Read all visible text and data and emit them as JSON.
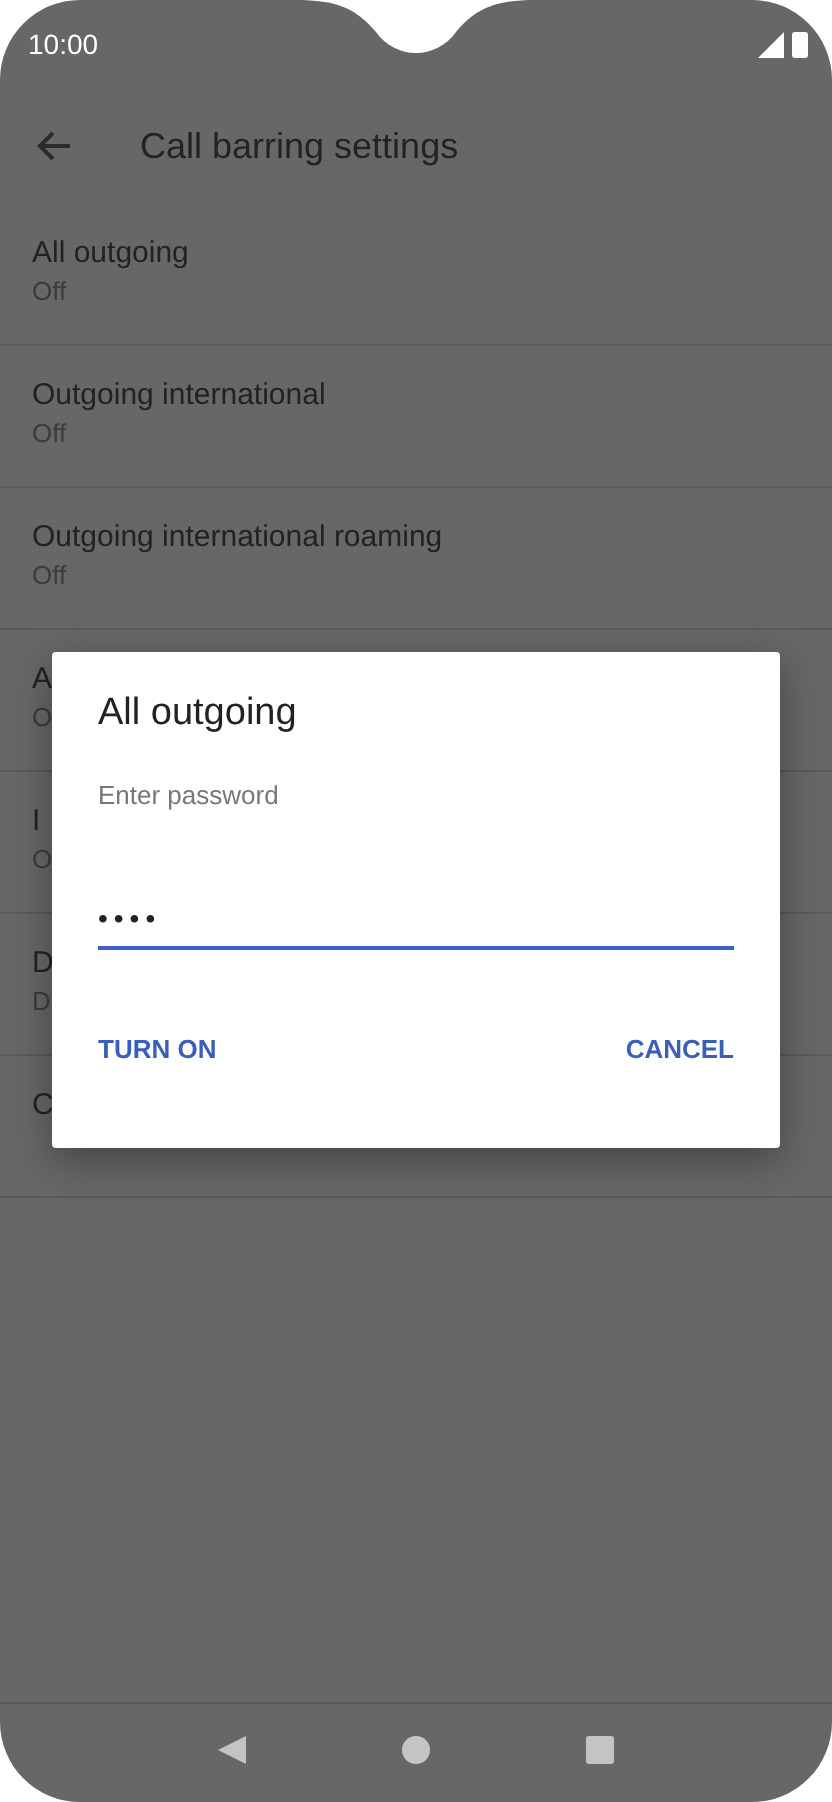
{
  "status_bar": {
    "time": "10:00"
  },
  "toolbar": {
    "title": "Call barring settings"
  },
  "settings": [
    {
      "title": "All outgoing",
      "subtitle": "Off"
    },
    {
      "title": "Outgoing international",
      "subtitle": "Off"
    },
    {
      "title": "Outgoing international roaming",
      "subtitle": "Off"
    },
    {
      "title": "A",
      "subtitle": "O"
    },
    {
      "title": "I",
      "subtitle": "O"
    },
    {
      "title": "D",
      "subtitle": "D"
    },
    {
      "title": "C"
    }
  ],
  "dialog": {
    "title": "All outgoing",
    "label": "Enter password",
    "value": "••••",
    "buttons": [
      {
        "label": "TURN ON"
      },
      {
        "label": "CANCEL"
      }
    ]
  }
}
